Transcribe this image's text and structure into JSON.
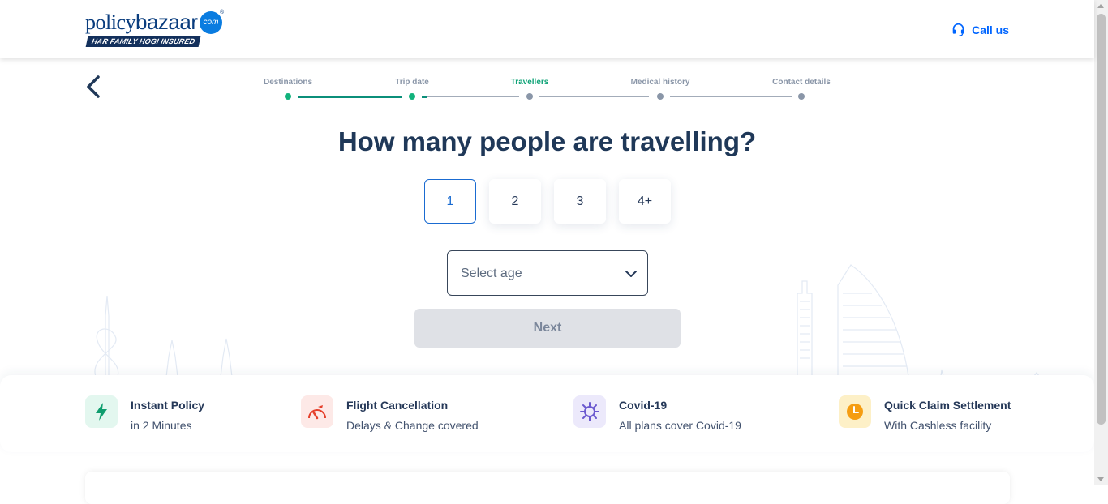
{
  "header": {
    "logo_text_1": "policy",
    "logo_text_2": "bazaar",
    "logo_dot": "com",
    "logo_tagline": "HAR FAMILY HOGI INSURED",
    "call_label": "Call us"
  },
  "steps": [
    {
      "label": "Destinations",
      "status": "done"
    },
    {
      "label": "Trip date",
      "status": "done"
    },
    {
      "label": "Travellers",
      "status": "active"
    },
    {
      "label": "Medical history",
      "status": "pending"
    },
    {
      "label": "Contact details",
      "status": "pending"
    }
  ],
  "question": "How many people are travelling?",
  "traveller_options": [
    "1",
    "2",
    "3",
    "4+"
  ],
  "selected_travellers": "1",
  "age_select": {
    "placeholder": "Select age"
  },
  "next_button": "Next",
  "features": [
    {
      "title": "Instant Policy",
      "subtitle": "in 2 Minutes",
      "icon": "lightning-icon",
      "bg": "#e3f7ef",
      "color": "#0f9d6e"
    },
    {
      "title": "Flight Cancellation",
      "subtitle": "Delays & Change covered",
      "icon": "flight-cancel-icon",
      "bg": "#fde9e7",
      "color": "#e5402c"
    },
    {
      "title": "Covid-19",
      "subtitle": "All plans cover Covid-19",
      "icon": "virus-icon",
      "bg": "#ece9fb",
      "color": "#6b59cf"
    },
    {
      "title": "Quick Claim Settlement",
      "subtitle": "With Cashless facility",
      "icon": "clock-icon",
      "bg": "#fdf0c7",
      "color": "#f59d12"
    }
  ],
  "colors": {
    "primary": "#0065ff",
    "heading": "#1f3858",
    "active_step": "#0fa377"
  }
}
